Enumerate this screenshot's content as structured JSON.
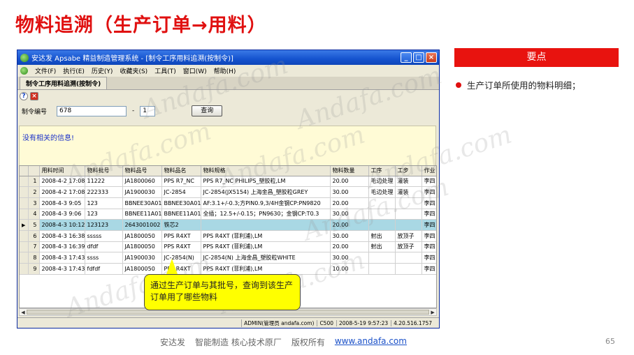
{
  "slide": {
    "title": "物料追溯（生产订单→用料）",
    "side_header": "要点",
    "side_bullet": "生产订单所使用的物料明细；",
    "callout": "通过生产订单与其批号，查询到该生产订单用了哪些物料",
    "footer_company": "安达发",
    "footer_tagline": "智能制造 核心技术原厂",
    "footer_rights": "版权所有",
    "footer_link": "www.andafa.com",
    "page_number": "65",
    "watermark": "Andafa.com"
  },
  "window": {
    "title": "安达发 Apsabe 精益制造管理系统 - [制令工序用料追溯(按制令)]",
    "menu": [
      "文件(F)",
      "执行(E)",
      "历史(Y)",
      "收藏夹(S)",
      "工具(T)",
      "窗口(W)",
      "帮助(H)"
    ],
    "tab": "制令工序用料追溯(按制令)",
    "form": {
      "order_label": "制令编号",
      "order_value": "678",
      "dash": "-",
      "batch_value": "1",
      "query_button": "查询"
    },
    "message": "没有相关的信息!",
    "columns": [
      "用料时间",
      "物料批号",
      "物料品号",
      "物料品名",
      "物料规格",
      "物料数量",
      "工序",
      "工步",
      "作业"
    ],
    "rows": [
      {
        "n": "1",
        "time": "2008-4-2 17:08",
        "batch": "11222",
        "code": "JA1800060",
        "name": "PPS R7_NC",
        "spec": "PPS R7_NC   PHILIPS_塑胶粒,LM",
        "qty": "20.00",
        "proc": "毛边处理",
        "step": "灌装",
        "op": "李四"
      },
      {
        "n": "2",
        "time": "2008-4-2 17:08",
        "batch": "222333",
        "code": "JA1900030",
        "name": "JC-2854",
        "spec": "JC-2854(JX5154)  上海金昌_塑胶粒GREY",
        "qty": "30.00",
        "proc": "毛边处理",
        "step": "灌装",
        "op": "李四"
      },
      {
        "n": "3",
        "time": "2008-4-3 9:05",
        "batch": "123",
        "code": "BBNEE30A01",
        "name": "BBNEE30A01",
        "spec": "AF:3.1+/-0.3;方PIN0.9,3/4H金钢CP:PN9820",
        "qty": "20.00",
        "proc": "",
        "step": "",
        "op": "李四"
      },
      {
        "n": "4",
        "time": "2008-4-3 9:06",
        "batch": "123",
        "code": "BBNEE11A01",
        "name": "BBNEE11A01",
        "spec": "全插；12.5+/-0.15；PN9630；金钢CP:T0.3",
        "qty": "30.00",
        "proc": "",
        "step": "",
        "op": "李四"
      },
      {
        "n": "5",
        "time": "2008-4-3 10:12",
        "batch": "123123",
        "code": "2643001002",
        "name": "铁芯2",
        "spec": "",
        "qty": "20.00",
        "proc": "",
        "step": "",
        "op": "李四",
        "selected": true
      },
      {
        "n": "6",
        "time": "2008-4-3 16:38",
        "batch": "sssss",
        "code": "JA1800050",
        "name": "PPS R4XT",
        "spec": "PPS R4XT (菲利浦),LM",
        "qty": "30.00",
        "proc": "射出",
        "step": "放顶子",
        "op": "李四"
      },
      {
        "n": "7",
        "time": "2008-4-3 16:39",
        "batch": "dfdf",
        "code": "JA1800050",
        "name": "PPS R4XT",
        "spec": "PPS R4XT (菲利浦),LM",
        "qty": "20.00",
        "proc": "射出",
        "step": "放顶子",
        "op": "李四"
      },
      {
        "n": "8",
        "time": "2008-4-3 17:43",
        "batch": "ssss",
        "code": "JA1900030",
        "name": "JC-2854(N)",
        "spec": "JC-2854(N)   上海金昌_塑胶粒WHITE",
        "qty": "30.00",
        "proc": "",
        "step": "",
        "op": "李四"
      },
      {
        "n": "9",
        "time": "2008-4-3 17:43",
        "batch": "fdfdf",
        "code": "JA1800050",
        "name": "PPS R4XT",
        "spec": "PPS R4XT (菲利浦),LM",
        "qty": "10.00",
        "proc": "",
        "step": "",
        "op": "李四"
      }
    ],
    "status": {
      "user": "ADMIN(管理员 andafa.com)",
      "code": "C500",
      "datetime": "2008-5-19 9:57:23",
      "version": "4.20.516.1757"
    }
  }
}
